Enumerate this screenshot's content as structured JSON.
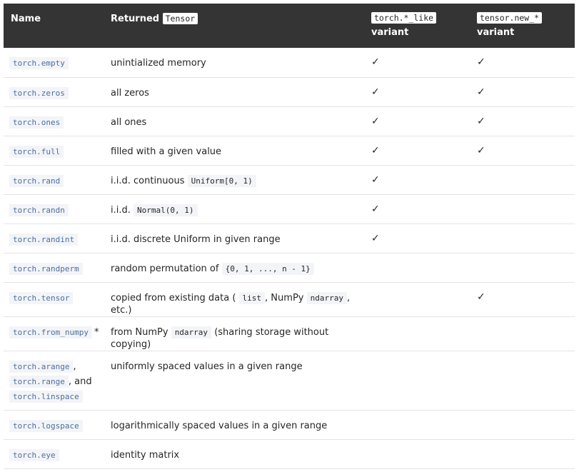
{
  "header": {
    "name": "Name",
    "returned_prefix": "Returned",
    "returned_code": "Tensor",
    "like_code": "torch.*_like",
    "like_suffix": "variant",
    "new_code": "tensor.new_*",
    "new_suffix": "variant"
  },
  "rows": [
    {
      "name": "torch.empty",
      "desc": "unintialized memory",
      "like": "✓",
      "new": "✓"
    },
    {
      "name": "torch.zeros",
      "desc": "all zeros",
      "like": "✓",
      "new": "✓"
    },
    {
      "name": "torch.ones",
      "desc": "all ones",
      "like": "✓",
      "new": "✓"
    },
    {
      "name": "torch.full",
      "desc": "filled with a given value",
      "like": "✓",
      "new": "✓"
    },
    {
      "name": "torch.rand",
      "desc_prefix": "i.i.d. continuous",
      "desc_code": "Uniform[0, 1)",
      "like": "✓",
      "new": ""
    },
    {
      "name": "torch.randn",
      "desc_prefix": "i.i.d.",
      "desc_code": "Normal(0, 1)",
      "like": "✓",
      "new": ""
    },
    {
      "name": "torch.randint",
      "desc": "i.i.d. discrete Uniform in given range",
      "like": "✓",
      "new": ""
    },
    {
      "name": "torch.randperm",
      "desc_prefix": "random permutation of",
      "desc_code": "{0, 1, ..., n - 1}",
      "like": "",
      "new": ""
    },
    {
      "name": "torch.tensor",
      "desc_prefix": "copied from existing data (",
      "desc_code1": "list",
      "desc_mid": ", NumPy",
      "desc_code2": "ndarray",
      "desc_suffix": ", etc.)",
      "like": "",
      "new": "✓"
    },
    {
      "name": "torch.from_numpy",
      "name_suffix": "*",
      "desc_prefix": "from NumPy",
      "desc_code": "ndarray",
      "desc_suffix": "(sharing storage without copying)",
      "like": "",
      "new": ""
    },
    {
      "names": [
        "torch.arange",
        "torch.range",
        "torch.linspace"
      ],
      "sep1": ",",
      "sep2": ", and",
      "desc": "uniformly spaced values in a given range",
      "like": "",
      "new": ""
    },
    {
      "name": "torch.logspace",
      "desc": "logarithmically spaced values in a given range",
      "like": "",
      "new": ""
    },
    {
      "name": "torch.eye",
      "desc": "identity matrix",
      "like": "",
      "new": ""
    }
  ]
}
